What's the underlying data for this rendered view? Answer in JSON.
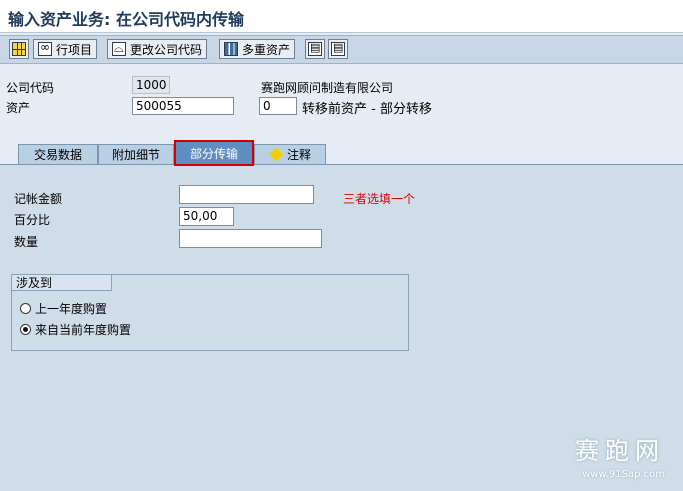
{
  "window": {
    "title": "输入资产业务: 在公司代码内传输"
  },
  "toolbar": {
    "items": [
      {
        "label": "",
        "icon": "grid-icon"
      },
      {
        "label": "行项目",
        "icon": "link-icon"
      },
      {
        "label": "更改公司代码",
        "icon": "headset-icon"
      },
      {
        "label": "多重资产",
        "icon": "blocks-icon"
      },
      {
        "label": "",
        "icon": "doc-icon"
      },
      {
        "label": "",
        "icon": "doc-edit-icon"
      }
    ]
  },
  "header": {
    "company_code_label": "公司代码",
    "company_code_value": "1000",
    "company_name": "赛跑网顾问制造有限公司",
    "asset_label": "资产",
    "asset_value": "500055",
    "subnumber_value": "0",
    "transfer_text": "转移前资产 - 部分转移"
  },
  "tabs": [
    {
      "label": "交易数据"
    },
    {
      "label": "附加细节"
    },
    {
      "label": "部分传输"
    },
    {
      "label": "注释"
    }
  ],
  "form": {
    "amount_label": "记帐金额",
    "amount_value": "",
    "percent_label": "百分比",
    "percent_value": "50,00",
    "quantity_label": "数量",
    "quantity_value": "",
    "hint": "三者选填一个"
  },
  "group": {
    "title": "涉及到",
    "options": [
      {
        "label": "上一年度购置",
        "selected": false
      },
      {
        "label": "来自当前年度购置",
        "selected": true
      }
    ]
  },
  "watermark": {
    "text": "赛跑网",
    "url": "www.91Sap.com"
  },
  "colors": {
    "accent": "#d40000",
    "hint_red": "#e00000",
    "panel": "#cfdde9"
  }
}
